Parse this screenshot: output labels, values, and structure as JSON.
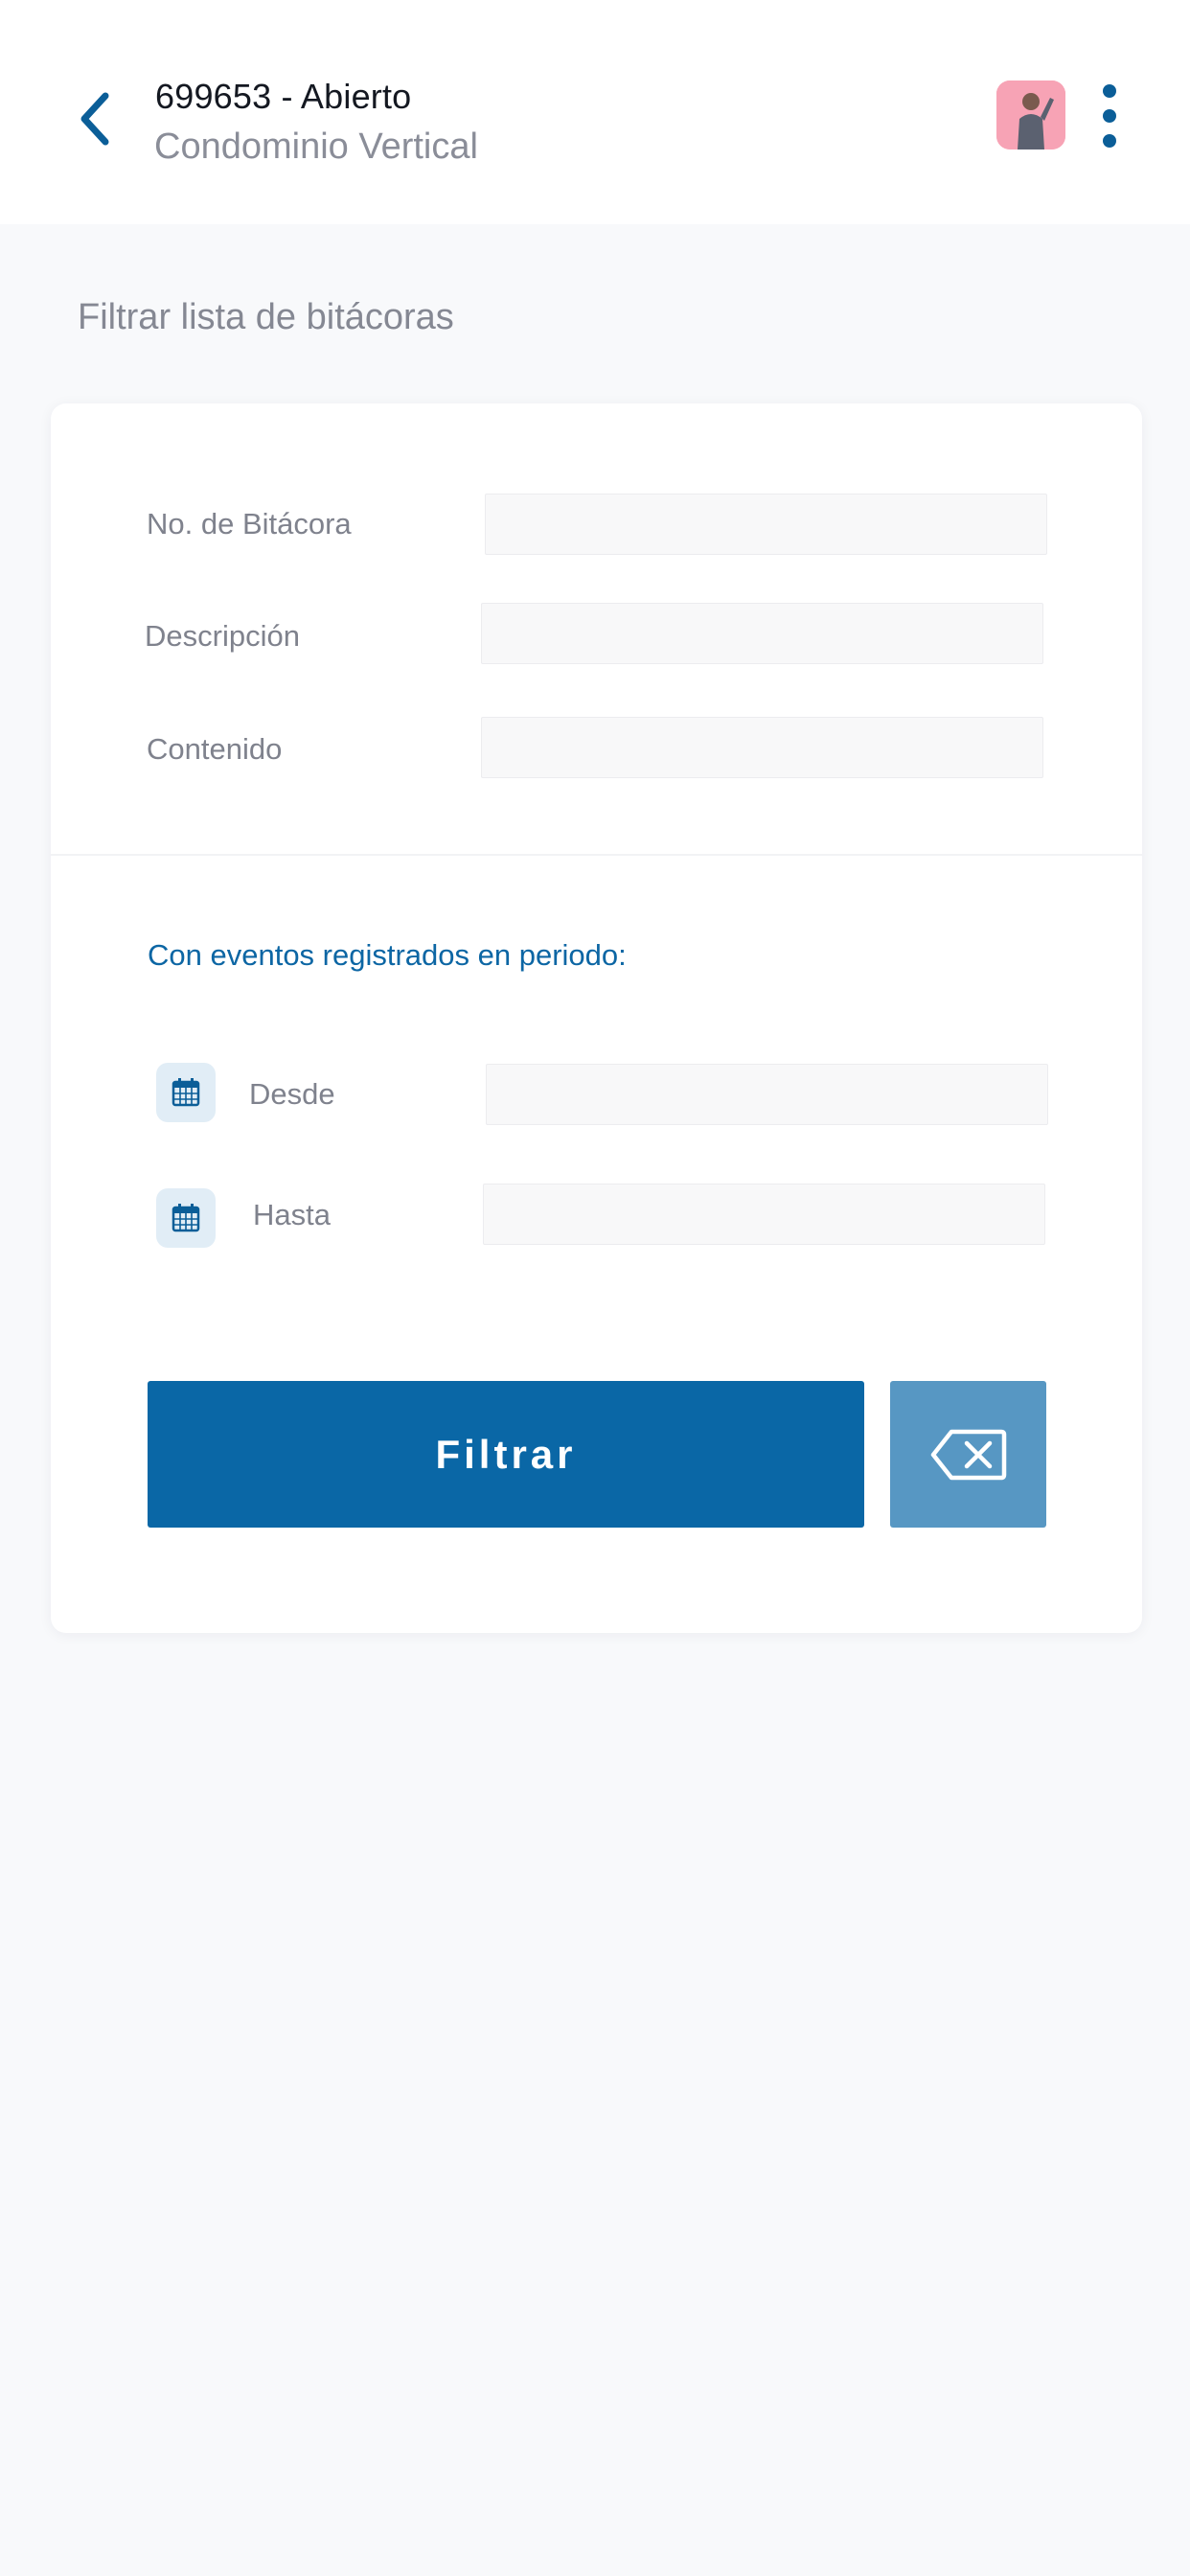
{
  "header": {
    "title": "699653 - Abierto",
    "subtitle": "Condominio Vertical"
  },
  "page": {
    "section_title": "Filtrar lista de bitácoras"
  },
  "form": {
    "fields": [
      {
        "label": "No. de Bitácora",
        "value": ""
      },
      {
        "label": "Descripción",
        "value": ""
      },
      {
        "label": "Contenido",
        "value": ""
      }
    ],
    "period_label": "Con eventos registrados en periodo:",
    "date_fields": [
      {
        "label": "Desde",
        "value": ""
      },
      {
        "label": "Hasta",
        "value": ""
      }
    ],
    "filter_button": "Filtrar"
  },
  "icons": {
    "back": "chevron-left-icon",
    "more": "more-vertical-icon",
    "calendar": "calendar-icon",
    "clear": "backspace-clear-icon"
  },
  "colors": {
    "accent": "#0a67a6",
    "clear_button": "#5797c3",
    "background": "#f8f9fb"
  }
}
